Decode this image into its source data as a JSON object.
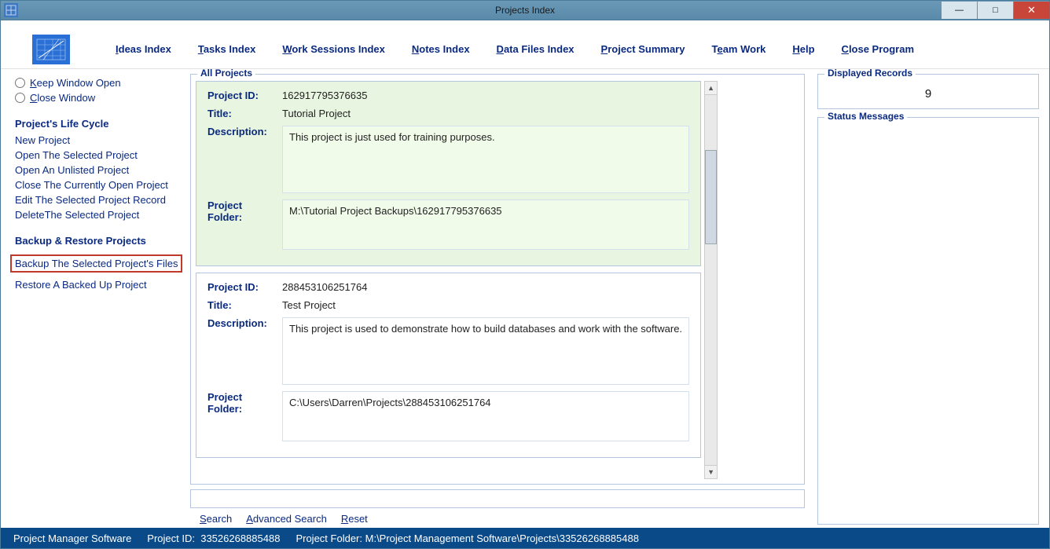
{
  "window": {
    "title": "Projects Index"
  },
  "menu": {
    "ideas": "Ideas Index",
    "tasks": "Tasks Index",
    "work": "Work Sessions Index",
    "notes": "Notes Index",
    "data": "Data Files Index",
    "summary": "Project Summary",
    "team": "Team Work",
    "help": "Help",
    "close": "Close Program"
  },
  "sidebar": {
    "keep_open": "Keep Window Open",
    "close_window": "Close Window",
    "lifecycle_title": "Project's Life Cycle",
    "new_project": "New Project",
    "open_selected": "Open The Selected Project",
    "open_unlisted": "Open An Unlisted Project",
    "close_current": "Close The Currently Open Project",
    "edit_selected": "Edit The Selected Project Record",
    "delete_selected": "DeleteThe Selected Project",
    "backup_title": "Backup & Restore Projects",
    "backup_selected": "Backup The Selected Project's Files",
    "restore": "Restore A Backed Up Project"
  },
  "list": {
    "legend": "All Projects",
    "labels": {
      "project_id": "Project ID:",
      "title": "Title:",
      "description": "Description:",
      "folder": "Project Folder:"
    },
    "projects": [
      {
        "project_id": "162917795376635",
        "title": "Tutorial Project",
        "description": "This project is just used for training purposes.",
        "folder": "M:\\Tutorial Project Backups\\162917795376635",
        "selected": true
      },
      {
        "project_id": "288453106251764",
        "title": "Test Project",
        "description": "This project is used to demonstrate how to build databases and work with the software.",
        "folder": "C:\\Users\\Darren\\Projects\\288453106251764",
        "selected": false
      }
    ]
  },
  "search": {
    "search": "Search",
    "advanced": "Advanced Search",
    "reset": "Reset"
  },
  "right": {
    "displayed_legend": "Displayed Records",
    "displayed_count": "9",
    "status_legend": "Status Messages"
  },
  "status": {
    "app": "Project Manager Software",
    "project_id_label": "Project ID:",
    "project_id": "33526268885488",
    "folder_label": "Project Folder:",
    "folder": "M:\\Project Management Software\\Projects\\33526268885488"
  }
}
